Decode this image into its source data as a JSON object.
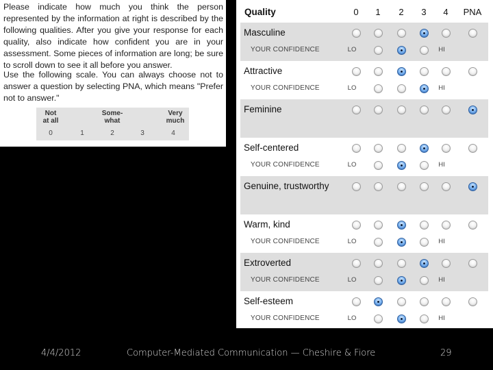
{
  "instructions": {
    "paragraph1": "Please indicate how much you think the person represented by the information at right is described by the following qualities. After you give your response for each quality, also indicate how confident you are in your assessment. Some pieces of information are long; be sure to scroll down to see it all before you answer.",
    "paragraph2": "Use the following scale. You can always choose not to answer a question by selecting PNA, which means \"Prefer not to answer.\""
  },
  "scale": {
    "anchors": [
      {
        "line1": "Not",
        "line2": "at all"
      },
      {
        "line1": "Some-",
        "line2": "what"
      },
      {
        "line1": "Very",
        "line2": "much"
      }
    ],
    "numbers": [
      "0",
      "1",
      "2",
      "3",
      "4"
    ]
  },
  "survey": {
    "header": {
      "quality": "Quality",
      "columns": [
        "0",
        "1",
        "2",
        "3",
        "4",
        "PNA"
      ]
    },
    "confidence_label": "YOUR CONFIDENCE",
    "lo_label": "LO",
    "hi_label": "HI",
    "rows": [
      {
        "quality": "Masculine",
        "selected": "3",
        "confidence": 2,
        "has_confidence": true,
        "shaded": true
      },
      {
        "quality": "Attractive",
        "selected": "2",
        "confidence": 3,
        "has_confidence": true,
        "shaded": false
      },
      {
        "quality": "Feminine",
        "selected": "PNA",
        "confidence": null,
        "has_confidence": false,
        "shaded": true
      },
      {
        "quality": "Self-centered",
        "selected": "3",
        "confidence": 2,
        "has_confidence": true,
        "shaded": false
      },
      {
        "quality": "Genuine, trustworthy",
        "selected": "PNA",
        "confidence": null,
        "has_confidence": false,
        "shaded": true
      },
      {
        "quality": "Warm, kind",
        "selected": "2",
        "confidence": 2,
        "has_confidence": true,
        "shaded": false
      },
      {
        "quality": "Extroverted",
        "selected": "3",
        "confidence": 2,
        "has_confidence": true,
        "shaded": true
      },
      {
        "quality": "Self-esteem",
        "selected": "1",
        "confidence": 2,
        "has_confidence": true,
        "shaded": false
      }
    ],
    "confidence_options": [
      1,
      2,
      3
    ]
  },
  "footer": {
    "date": "4/4/2012",
    "title": "Computer-Mediated Communication — Cheshire & Fiore",
    "page": "29"
  },
  "colors": {
    "row_shade": "#dedede",
    "selected_radio": "#2f6fc6",
    "background": "#000000"
  }
}
